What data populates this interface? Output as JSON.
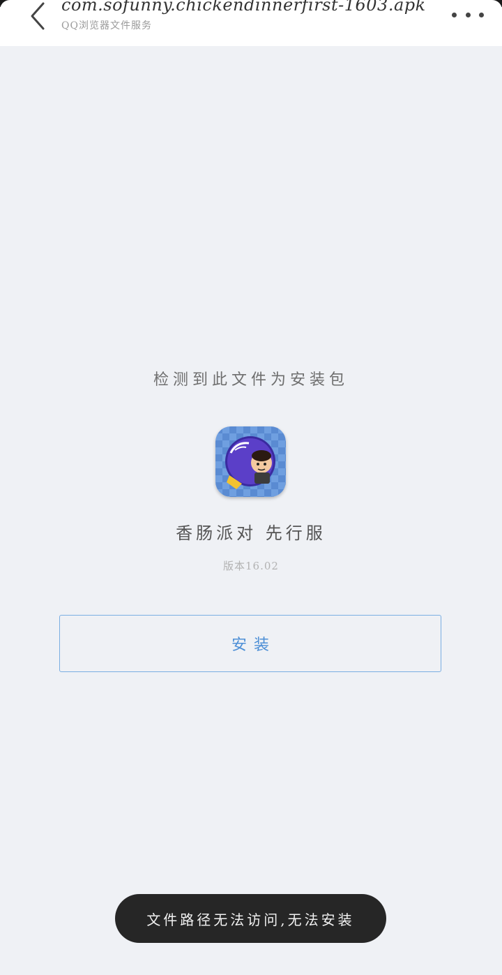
{
  "header": {
    "title": "com.sofunny.chickendinnerfirst-1603.apk",
    "subtitle": "QQ浏览器文件服务",
    "back_icon": "chevron-left-icon",
    "more_icon": "more-horizontal-icon"
  },
  "main": {
    "detect_text": "检测到此文件为安装包",
    "app_name": "香肠派对 先行服",
    "version": "版本16.02",
    "install_label": "安装"
  },
  "toast": {
    "message": "文件路径无法访问,无法安装"
  },
  "colors": {
    "background": "#eff1f5",
    "accent": "#4d8fd6",
    "toast_bg": "#262626"
  }
}
